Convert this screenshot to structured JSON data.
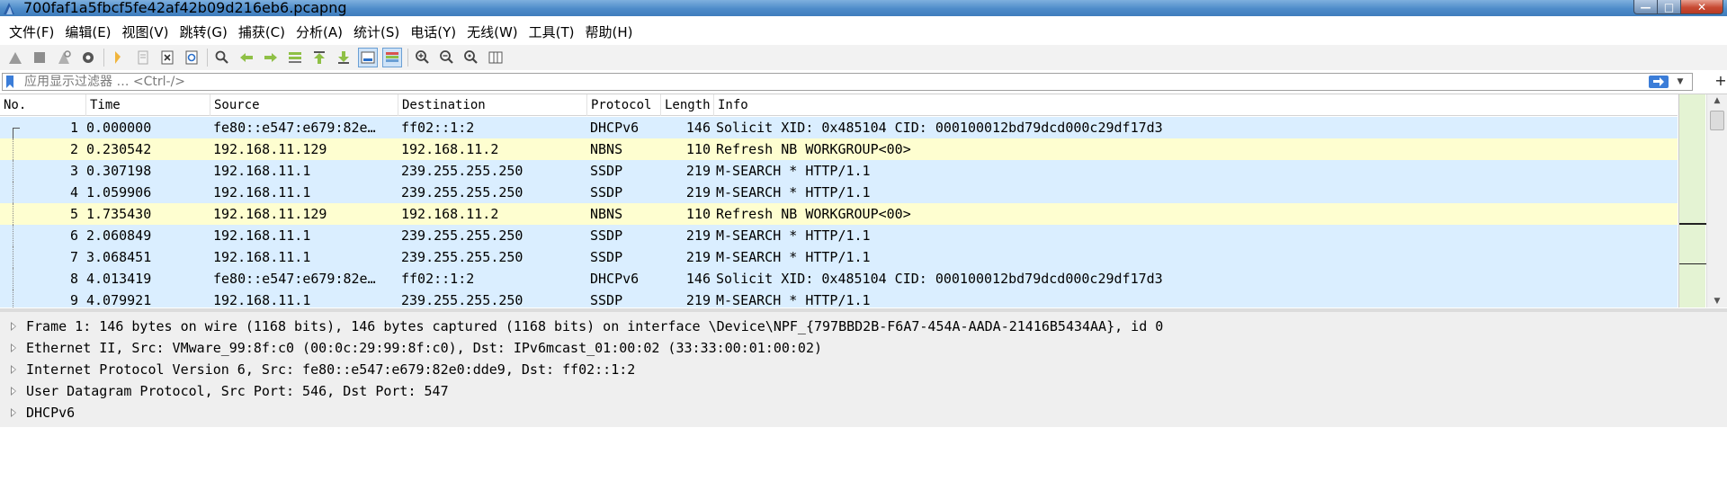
{
  "window": {
    "title": "700faf1a5fbcf5fe42af42b09d216eb6.pcapng",
    "controls": {
      "minimize": "—",
      "maximize": "□",
      "close": "✕"
    }
  },
  "menu": [
    "文件(F)",
    "编辑(E)",
    "视图(V)",
    "跳转(G)",
    "捕获(C)",
    "分析(A)",
    "统计(S)",
    "电话(Y)",
    "无线(W)",
    "工具(T)",
    "帮助(H)"
  ],
  "toolbar": {
    "icons": [
      "shark-fin-start-icon",
      "stop-icon",
      "restart-icon",
      "options-gear-icon",
      "open-folder-icon",
      "save-file-icon",
      "close-file-icon",
      "reload-icon",
      "find-icon",
      "back-arrow-icon",
      "forward-arrow-icon",
      "go-to-packet-icon",
      "first-packet-icon",
      "last-packet-icon",
      "autoscroll-icon",
      "colorize-icon",
      "zoom-in-icon",
      "zoom-out-icon",
      "zoom-normal-icon",
      "resize-columns-icon"
    ]
  },
  "filter": {
    "placeholder": "应用显示过滤器 … <Ctrl-/>",
    "add_label": "+"
  },
  "packet_list": {
    "columns": {
      "no": "No.",
      "time": "Time",
      "source": "Source",
      "destination": "Destination",
      "protocol": "Protocol",
      "length": "Length",
      "info": "Info"
    },
    "rows": [
      {
        "no": "1",
        "time": "0.000000",
        "source": "fe80::e547:e679:82e…",
        "destination": "ff02::1:2",
        "protocol": "DHCPv6",
        "length": "146",
        "info": "Solicit XID: 0x485104 CID: 000100012bd79dcd000c29df17d3",
        "color": "udp"
      },
      {
        "no": "2",
        "time": "0.230542",
        "source": "192.168.11.129",
        "destination": "192.168.11.2",
        "protocol": "NBNS",
        "length": "110",
        "info": "Refresh NB WORKGROUP<00>",
        "color": "nbns"
      },
      {
        "no": "3",
        "time": "0.307198",
        "source": "192.168.11.1",
        "destination": "239.255.255.250",
        "protocol": "SSDP",
        "length": "219",
        "info": "M-SEARCH * HTTP/1.1",
        "color": "udp"
      },
      {
        "no": "4",
        "time": "1.059906",
        "source": "192.168.11.1",
        "destination": "239.255.255.250",
        "protocol": "SSDP",
        "length": "219",
        "info": "M-SEARCH * HTTP/1.1",
        "color": "udp"
      },
      {
        "no": "5",
        "time": "1.735430",
        "source": "192.168.11.129",
        "destination": "192.168.11.2",
        "protocol": "NBNS",
        "length": "110",
        "info": "Refresh NB WORKGROUP<00>",
        "color": "nbns"
      },
      {
        "no": "6",
        "time": "2.060849",
        "source": "192.168.11.1",
        "destination": "239.255.255.250",
        "protocol": "SSDP",
        "length": "219",
        "info": "M-SEARCH * HTTP/1.1",
        "color": "udp"
      },
      {
        "no": "7",
        "time": "3.068451",
        "source": "192.168.11.1",
        "destination": "239.255.255.250",
        "protocol": "SSDP",
        "length": "219",
        "info": "M-SEARCH * HTTP/1.1",
        "color": "udp"
      },
      {
        "no": "8",
        "time": "4.013419",
        "source": "fe80::e547:e679:82e…",
        "destination": "ff02::1:2",
        "protocol": "DHCPv6",
        "length": "146",
        "info": "Solicit XID: 0x485104 CID: 000100012bd79dcd000c29df17d3",
        "color": "udp"
      },
      {
        "no": "9",
        "time": "4.079921",
        "source": "192.168.11.1",
        "destination": "239.255.255.250",
        "protocol": "SSDP",
        "length": "219",
        "info": "M-SEARCH * HTTP/1.1",
        "color": "udp"
      }
    ]
  },
  "details": [
    "Frame 1: 146 bytes on wire (1168 bits), 146 bytes captured (1168 bits) on interface \\Device\\NPF_{797BBD2B-F6A7-454A-AADA-21416B5434AA}, id 0",
    "Ethernet II, Src: VMware_99:8f:c0 (00:0c:29:99:8f:c0), Dst: IPv6mcast_01:00:02 (33:33:00:01:00:02)",
    "Internet Protocol Version 6, Src: fe80::e547:e679:82e0:dde9, Dst: ff02::1:2",
    "User Datagram Protocol, Src Port: 546, Dst Port: 547",
    "DHCPv6"
  ],
  "colors": {
    "udp_row": "#daeeff",
    "nbns_row": "#fefed0",
    "titlebar": "#4d8bc9",
    "minimap": "#e4f3d3"
  }
}
